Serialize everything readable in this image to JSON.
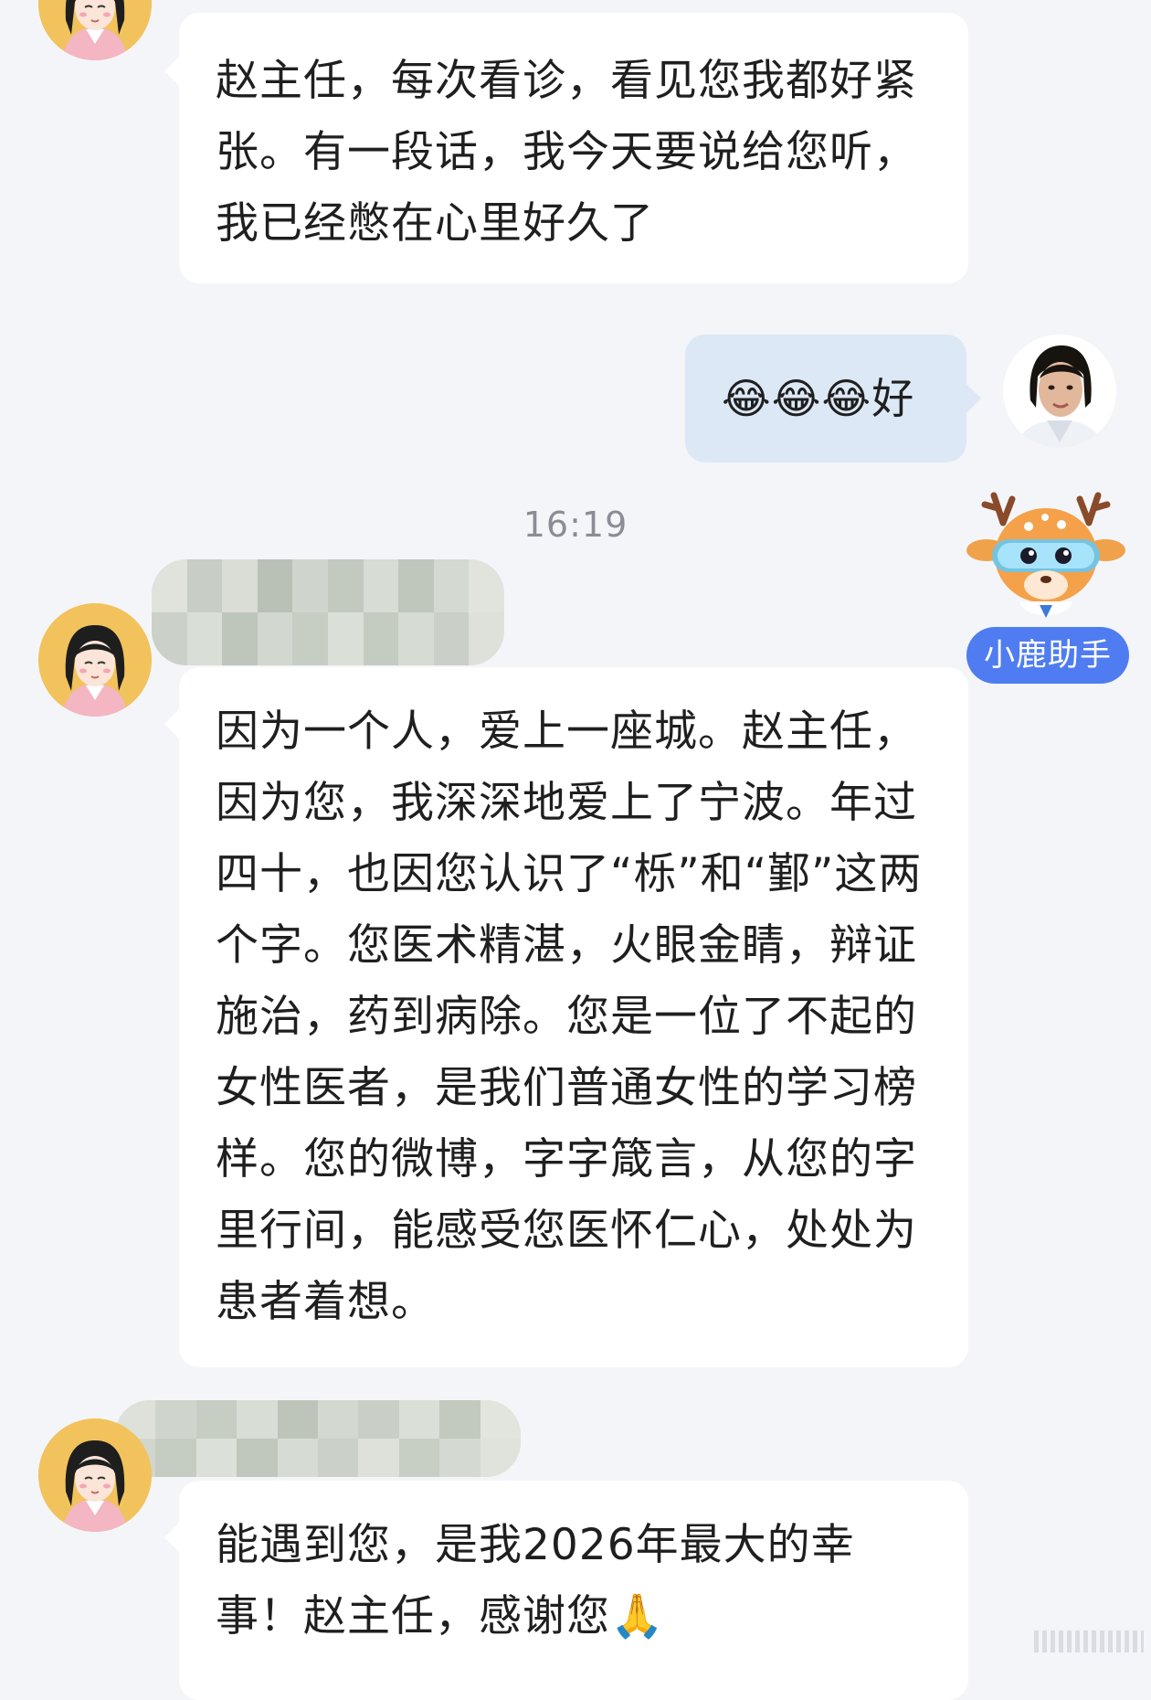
{
  "messages": [
    {
      "sender": "patient",
      "lines": [
        "赵主任，每次看诊，看见您我都好紧",
        "张。有一段话，我今天要说给您听，",
        "我已经憋在心里好久了"
      ]
    },
    {
      "sender": "doctor",
      "text": "😂😂😂好"
    },
    {
      "sender": "patient",
      "lines": [
        "因为一个人，爱上一座城。赵主任，",
        "因为您，我深深地爱上了宁波。年过",
        "四十，也因您认识了“栎”和“鄞”这两",
        "个字。您医术精湛，火眼金睛，辩证",
        "施治，药到病除。您是一位了不起的",
        "女性医者，是我们普通女性的学习榜",
        "样。您的微博，字字箴言，从您的字",
        "里行间，能感受您医怀仁心，处处为",
        "患者着想。"
      ]
    },
    {
      "sender": "patient",
      "lines": [
        "能遇到您，是我2026年最大的幸",
        "事！赵主任，感谢您🙏"
      ]
    }
  ],
  "timestamp": "16:19",
  "assistant": {
    "badge_label": "小鹿助手",
    "icon": "deer-mascot-icon"
  },
  "colors": {
    "background": "#f4f5f9",
    "incoming_bubble": "#ffffff",
    "outgoing_bubble": "#dde8f6",
    "assistant_badge": "#4f7cf0",
    "avatar_bg": "#f2c25c"
  }
}
